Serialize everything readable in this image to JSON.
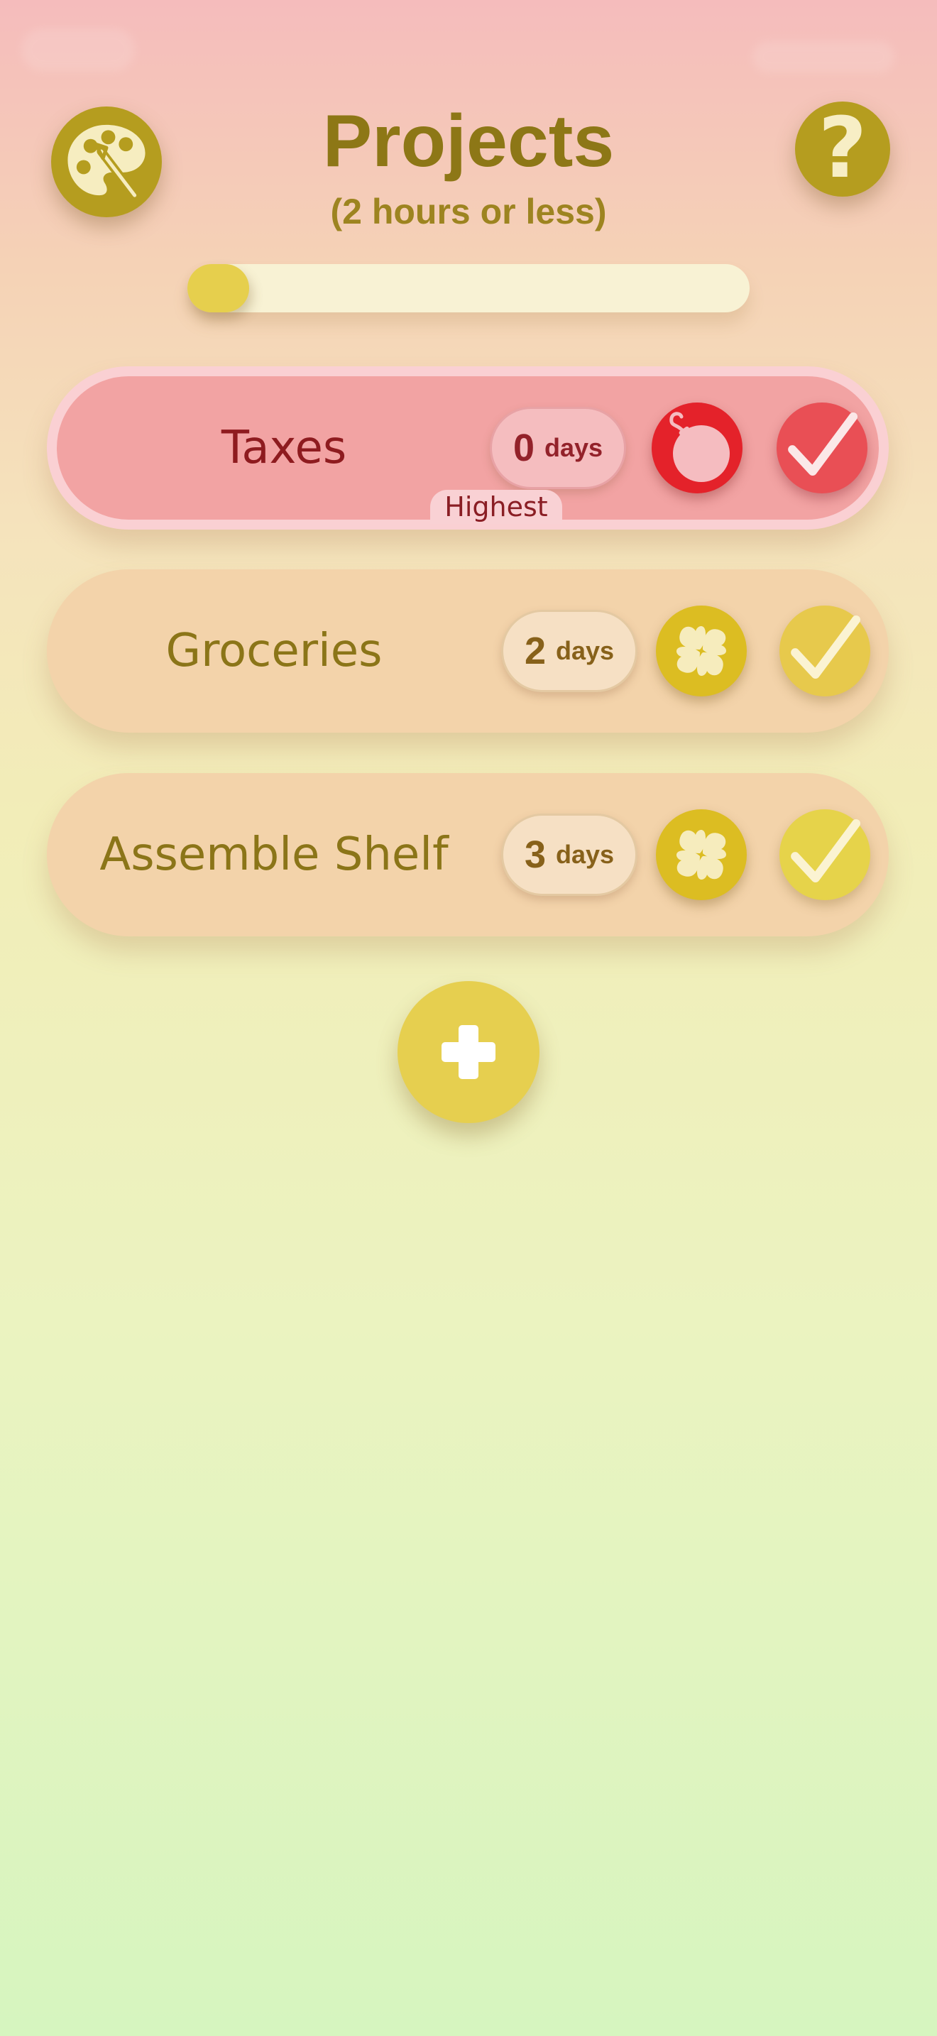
{
  "header": {
    "title": "Projects",
    "subtitle": "(2 hours or less)"
  },
  "icons": {
    "theme": "palette-icon",
    "help": "question-mark-icon",
    "urgent": "bomb-icon",
    "normal": "clover-icon",
    "complete": "checkmark-icon",
    "add": "plus-icon"
  },
  "help_button_label": "?",
  "progress": {
    "fraction": 0.11
  },
  "tasks": [
    {
      "name": "Taxes",
      "days": "0",
      "days_unit": "days",
      "priority": "Highest"
    },
    {
      "name": "Groceries",
      "days": "2",
      "days_unit": "days"
    },
    {
      "name": "Assemble Shelf",
      "days": "3",
      "days_unit": "days"
    }
  ],
  "colors": {
    "accent": "#b59d1f",
    "title_text": "#8d7716",
    "urgent_red": "#e4222a",
    "highest_card": "#f2a3a3",
    "normal_card": "#f3d3aa",
    "add_button": "#e6cf4f"
  }
}
